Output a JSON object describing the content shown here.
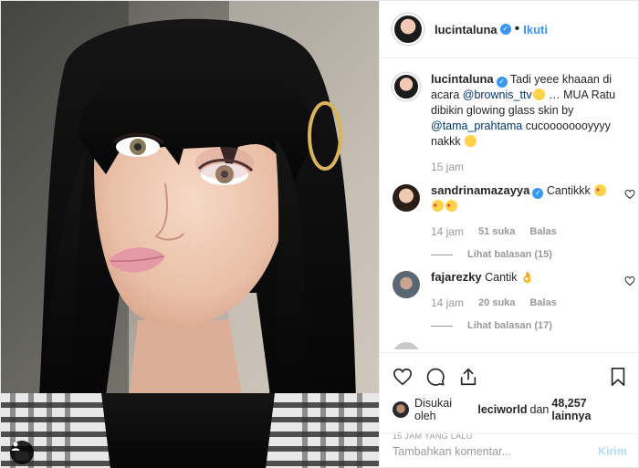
{
  "header": {
    "username": "lucintaluna",
    "separator": "•",
    "follow_label": "Ikuti"
  },
  "caption": {
    "username": "lucintaluna",
    "text_a": " Tadi yeee khaaan di acara ",
    "mention1": "@brownis_ttv",
    "text_b": " … MUA Ratu dibikin glowing glass skin by ",
    "mention2": "@tama_prahtama",
    "text_c": " cucoooooooyyyy nakkk ",
    "time": "15 jam"
  },
  "comments": [
    {
      "username": "sandrinamazayya",
      "text": " Cantikkk ",
      "time": "14 jam",
      "likes": "51 suka",
      "reply": "Balas",
      "view_replies": "Lihat balasan (15)"
    },
    {
      "username": "fajarezky",
      "text": " Cantik ",
      "time": "14 jam",
      "likes": "20 suka",
      "reply": "Balas",
      "view_replies": "Lihat balasan (17)"
    }
  ],
  "likes_line": {
    "prefix": "Disukai oleh ",
    "user": "leciworld",
    "middle": " dan ",
    "count": "48,257 lainnya"
  },
  "post_time": "15 JAM YANG LALU",
  "add_comment": {
    "placeholder": "Tambahkan komentar...",
    "post_label": "Kirim"
  },
  "colors": {
    "accent": "#3897f0",
    "mention": "#003569",
    "muted": "#999999",
    "post_disabled": "#b2dffc"
  },
  "icons": [
    "heart-icon",
    "comment-icon",
    "share-icon",
    "bookmark-icon",
    "verified-icon",
    "user-tag-icon"
  ]
}
